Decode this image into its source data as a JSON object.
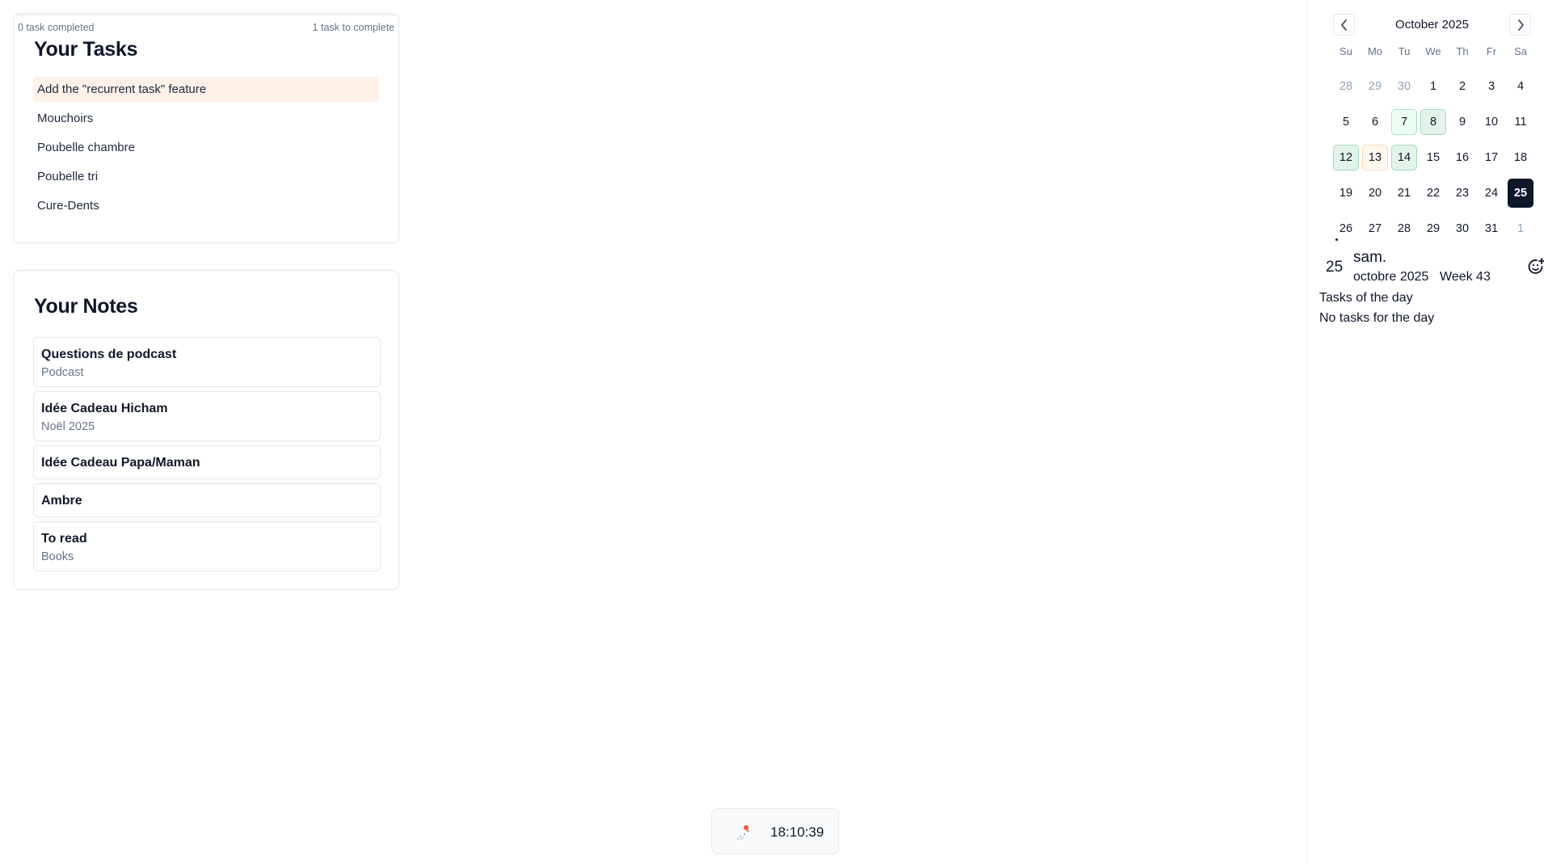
{
  "tasks": {
    "completed_label": "0 task completed",
    "remaining_label": "1 task to complete",
    "title": "Your Tasks",
    "items": [
      {
        "label": "Add the \"recurrent task\" feature"
      },
      {
        "label": "Mouchoirs"
      },
      {
        "label": "Poubelle chambre"
      },
      {
        "label": "Poubelle tri"
      },
      {
        "label": "Cure-Dents"
      }
    ]
  },
  "notes": {
    "title": "Your Notes",
    "items": [
      {
        "title": "Questions de podcast",
        "subtitle": "Podcast"
      },
      {
        "title": "Idée Cadeau Hicham",
        "subtitle": "Noël 2025"
      },
      {
        "title": "Idée Cadeau Papa/Maman",
        "subtitle": ""
      },
      {
        "title": "Ambre",
        "subtitle": ""
      },
      {
        "title": "To read",
        "subtitle": "Books"
      }
    ]
  },
  "clock": {
    "time": "18:10:39",
    "icon": "spinner-icon"
  },
  "calendar": {
    "month_label": "October 2025",
    "weekdays": [
      "Su",
      "Mo",
      "Tu",
      "We",
      "Th",
      "Fr",
      "Sa"
    ],
    "weeks": [
      [
        "28",
        "29",
        "30",
        "1",
        "2",
        "3",
        "4"
      ],
      [
        "5",
        "6",
        "7",
        "8",
        "9",
        "10",
        "11"
      ],
      [
        "12",
        "13",
        "14",
        "15",
        "16",
        "17",
        "18"
      ],
      [
        "19",
        "20",
        "21",
        "22",
        "23",
        "24",
        "25"
      ],
      [
        "26",
        "27",
        "28",
        "29",
        "30",
        "31",
        "1"
      ]
    ],
    "selected_day": "25"
  },
  "day_detail": {
    "day_number": "25",
    "weekday": "sam.",
    "month_year": "octobre 2025",
    "week": "Week 43",
    "tasks_heading": "Tasks of the day",
    "empty_text": "No tasks for the day"
  }
}
